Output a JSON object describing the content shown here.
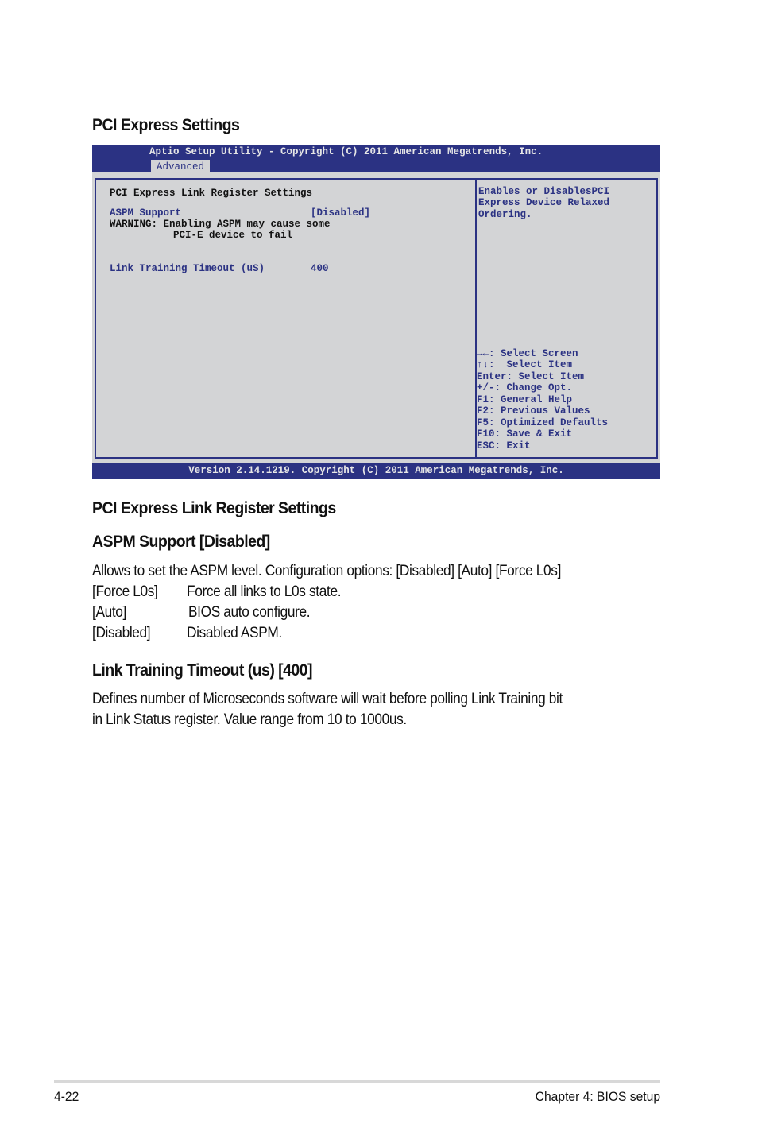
{
  "page_title": "PCI Express Settings",
  "bios": {
    "title_bar": "Aptio Setup Utility - Copyright (C) 2011 American Megatrends, Inc.",
    "active_tab": "Advanced",
    "section_title": "PCI Express Link Register Settings",
    "items": [
      {
        "label": "ASPM Support",
        "value": "[Disabled]"
      },
      {
        "label": "Link Training Timeout (uS)",
        "value": "400"
      }
    ],
    "warning_line1": "WARNING: Enabling ASPM may cause some",
    "warning_line2": "PCI-E device to fail",
    "help_text": [
      "Enables or DisablesPCI",
      "Express Device Relaxed",
      "Ordering."
    ],
    "key_legend": [
      "→←: Select Screen",
      "↑↓:  Select Item",
      "Enter: Select Item",
      "+/-: Change Opt.",
      "F1: General Help",
      "F2: Previous Values",
      "F5: Optimized Defaults",
      "F10: Save & Exit",
      "ESC: Exit"
    ],
    "footer": "Version 2.14.1219. Copyright (C) 2011 American Megatrends, Inc."
  },
  "sections": {
    "link_register_heading": "PCI Express Link Register Settings",
    "aspm": {
      "heading": "ASPM Support [Disabled]",
      "description": "Allows to set the ASPM level. Configuration options: [Disabled] [Auto] [Force L0s]",
      "options": [
        {
          "key": "[Force L0s]",
          "desc": "Force all links to L0s state."
        },
        {
          "key": "[Auto]",
          "desc": "BIOS auto configure."
        },
        {
          "key": "[Disabled]",
          "desc": "Disabled ASPM."
        }
      ]
    },
    "link_training": {
      "heading": "Link Training Timeout (us) [400]",
      "description_line1": "Defines number of Microseconds software will wait before polling Link Training bit",
      "description_line2": "in Link Status register. Value range from 10 to 1000us."
    }
  },
  "footer": {
    "page_number": "4-22",
    "chapter": "Chapter 4: BIOS setup"
  }
}
